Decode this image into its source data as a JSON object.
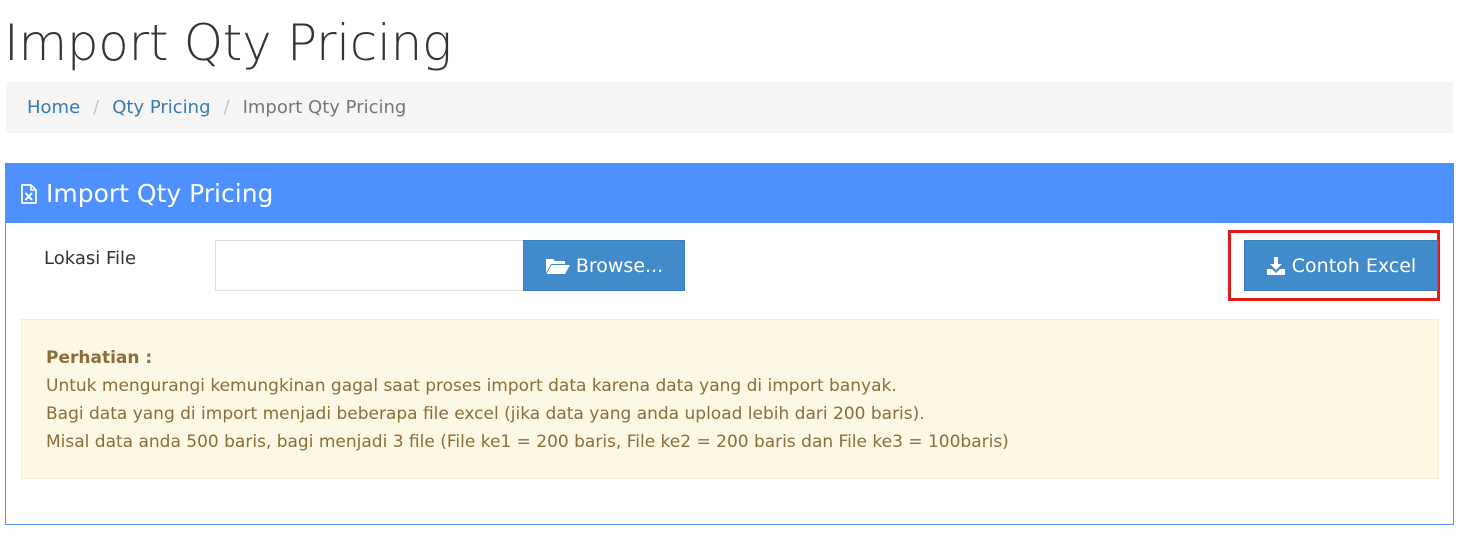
{
  "page": {
    "title": "Import Qty Pricing"
  },
  "breadcrumb": {
    "items": [
      {
        "label": "Home"
      },
      {
        "label": "Qty Pricing"
      }
    ],
    "separator": "/",
    "active": "Import Qty Pricing"
  },
  "panel": {
    "title": "Import Qty Pricing",
    "icon": "file-excel-icon",
    "accent_color": "#4d90fe"
  },
  "form": {
    "file_label": "Lokasi File",
    "file_value": "",
    "browse_label": "Browse...",
    "browse_icon": "folder-open-icon",
    "download_label": "Contoh Excel",
    "download_icon": "download-icon",
    "button_color": "#428bca",
    "highlight_color": "#e01b1b"
  },
  "notice": {
    "title": "Perhatian :",
    "lines": [
      "Untuk mengurangi kemungkinan gagal saat proses import data karena data yang di import banyak.",
      "Bagi data yang di import menjadi beberapa file excel (jika data yang anda upload lebih dari 200 baris).",
      "Misal data anda 500 baris, bagi menjadi 3 file (File ke1 = 200 baris, File ke2 = 200 baris dan File ke3 = 100baris)"
    ],
    "background_color": "#fcf8e3",
    "text_color": "#8a6d3b"
  }
}
